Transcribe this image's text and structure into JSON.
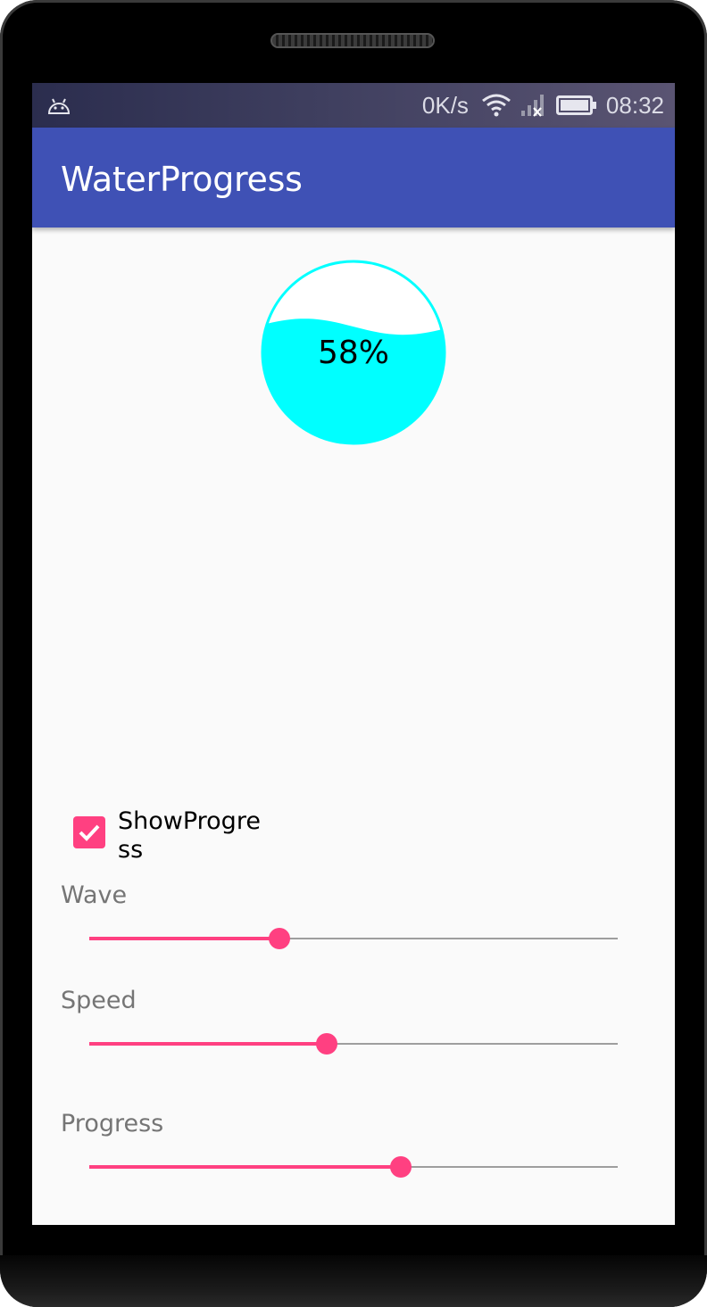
{
  "status_bar": {
    "network_speed": "0K/s",
    "time": "08:32",
    "icons": [
      "android-icon",
      "wifi-icon",
      "cellular-signal-icon",
      "battery-icon"
    ]
  },
  "app_bar": {
    "title": "WaterProgress"
  },
  "water_progress": {
    "label": "58%",
    "level": 0.58,
    "wave_color": "#00ffff",
    "border_color": "#00ffff"
  },
  "show_progress": {
    "label": "ShowProgress",
    "checked": true
  },
  "sliders": [
    {
      "label": "Wave",
      "value": 0.36
    },
    {
      "label": "Speed",
      "value": 0.45
    },
    {
      "label": "Progress",
      "value": 0.59
    }
  ],
  "colors": {
    "primary": "#3f51b5",
    "accent": "#ff4081",
    "track": "#9e9e9e"
  }
}
